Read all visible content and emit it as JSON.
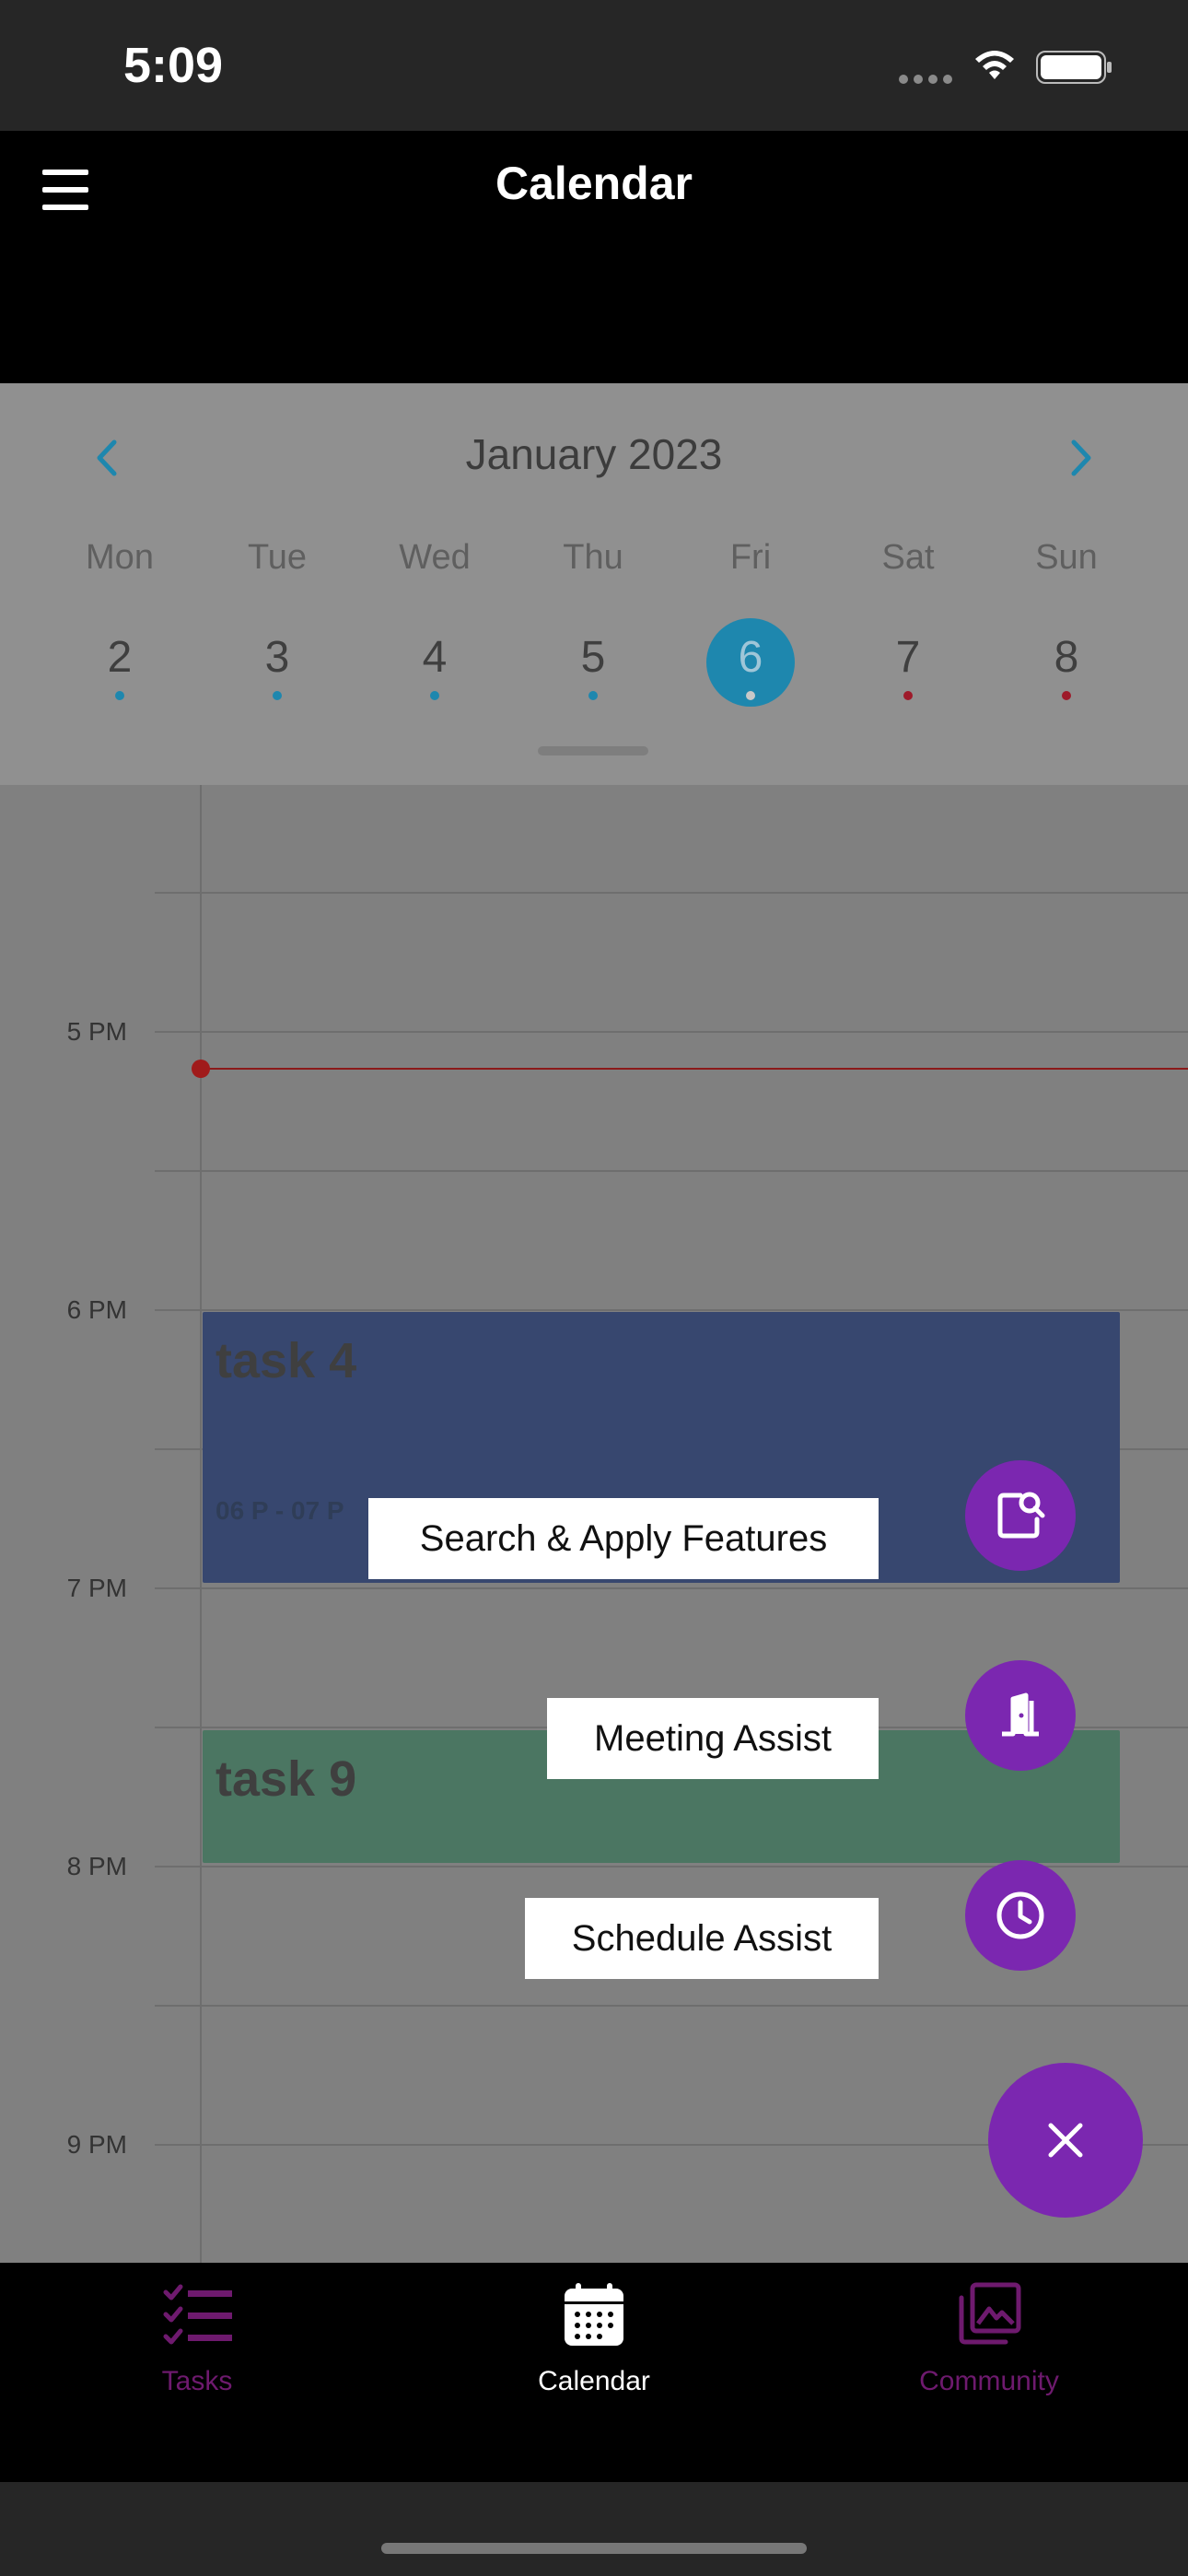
{
  "status_bar": {
    "time": "5:09"
  },
  "header": {
    "title": "Calendar"
  },
  "calendar_strip": {
    "month": "January 2023",
    "weekdays": [
      "Mon",
      "Tue",
      "Wed",
      "Thu",
      "Fri",
      "Sat",
      "Sun"
    ],
    "days": [
      "2",
      "3",
      "4",
      "5",
      "6",
      "7",
      "8"
    ],
    "selected_day": "6",
    "dot_colors": [
      "#1e87ae",
      "#1e87ae",
      "#1e87ae",
      "#1e87ae",
      "#c8c8c8",
      "#9e1a2a",
      "#9e1a2a"
    ]
  },
  "time_grid": {
    "hours": [
      "5 PM",
      "6 PM",
      "7 PM",
      "8 PM",
      "9 PM"
    ]
  },
  "events": [
    {
      "title": "task 4",
      "time": "06 P - 07 P",
      "color": "#37476f"
    },
    {
      "title": "task 9",
      "color": "#4b7662"
    }
  ],
  "fab_menu": {
    "search_label": "Search & Apply Features",
    "meeting_label": "Meeting Assist",
    "schedule_label": "Schedule Assist",
    "accent_color": "#7b27b0"
  },
  "bottom_nav": {
    "tasks_label": "Tasks",
    "calendar_label": "Calendar",
    "community_label": "Community"
  }
}
